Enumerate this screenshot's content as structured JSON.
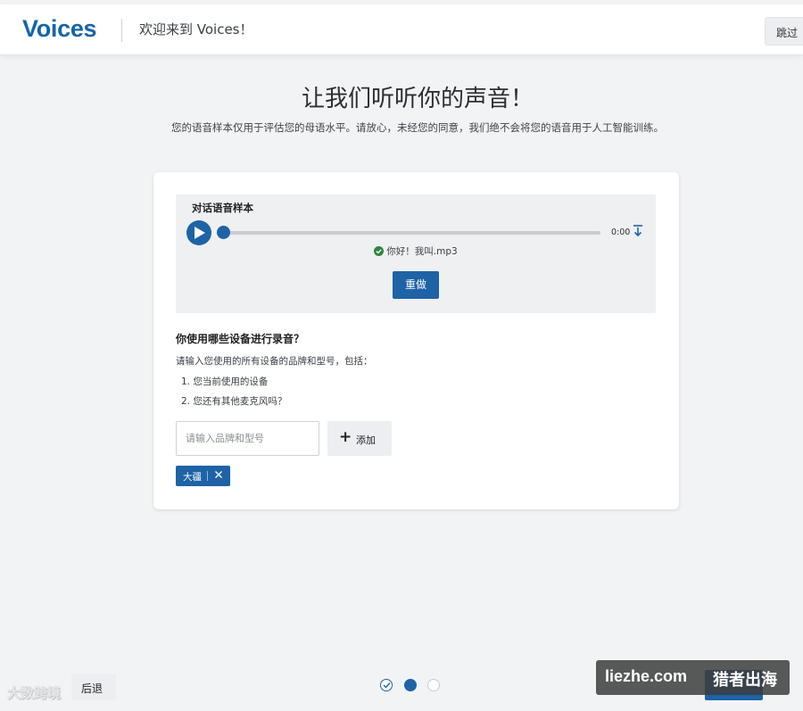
{
  "header": {
    "brand": "Voices",
    "welcome": "欢迎来到 Voices！",
    "skip_label": "跳过"
  },
  "page": {
    "title": "让我们听听你的声音！",
    "subtitle": "您的语音样本仅用于评估您的母语水平。请放心，未经您的同意，我们绝不会将您的语音用于人工智能训练。"
  },
  "sample": {
    "title": "对话语音样本",
    "time": "0:00",
    "progress": 0,
    "file_name": "你好！我叫.mp3",
    "redo_label": "重做"
  },
  "devices": {
    "question": "你使用哪些设备进行录音？",
    "instruction": "请输入您使用的所有设备的品牌和型号，包括：",
    "list": [
      "1. 您当前使用的设备",
      "2. 您还有其他麦克风吗？"
    ],
    "input_placeholder": "请输入品牌和型号",
    "input_value": "",
    "add_label": "添加",
    "tags": [
      "大疆"
    ]
  },
  "footer": {
    "back_label": "后退",
    "steps": 3,
    "current_step": 2
  },
  "watermarks": {
    "left": "大数跨境",
    "right_a": "liezhe.com",
    "right_b": "猎者出海"
  },
  "colors": {
    "primary": "#1d63a6",
    "brand": "#1565a8",
    "background": "#f2f3f5",
    "success": "#2e8540"
  }
}
